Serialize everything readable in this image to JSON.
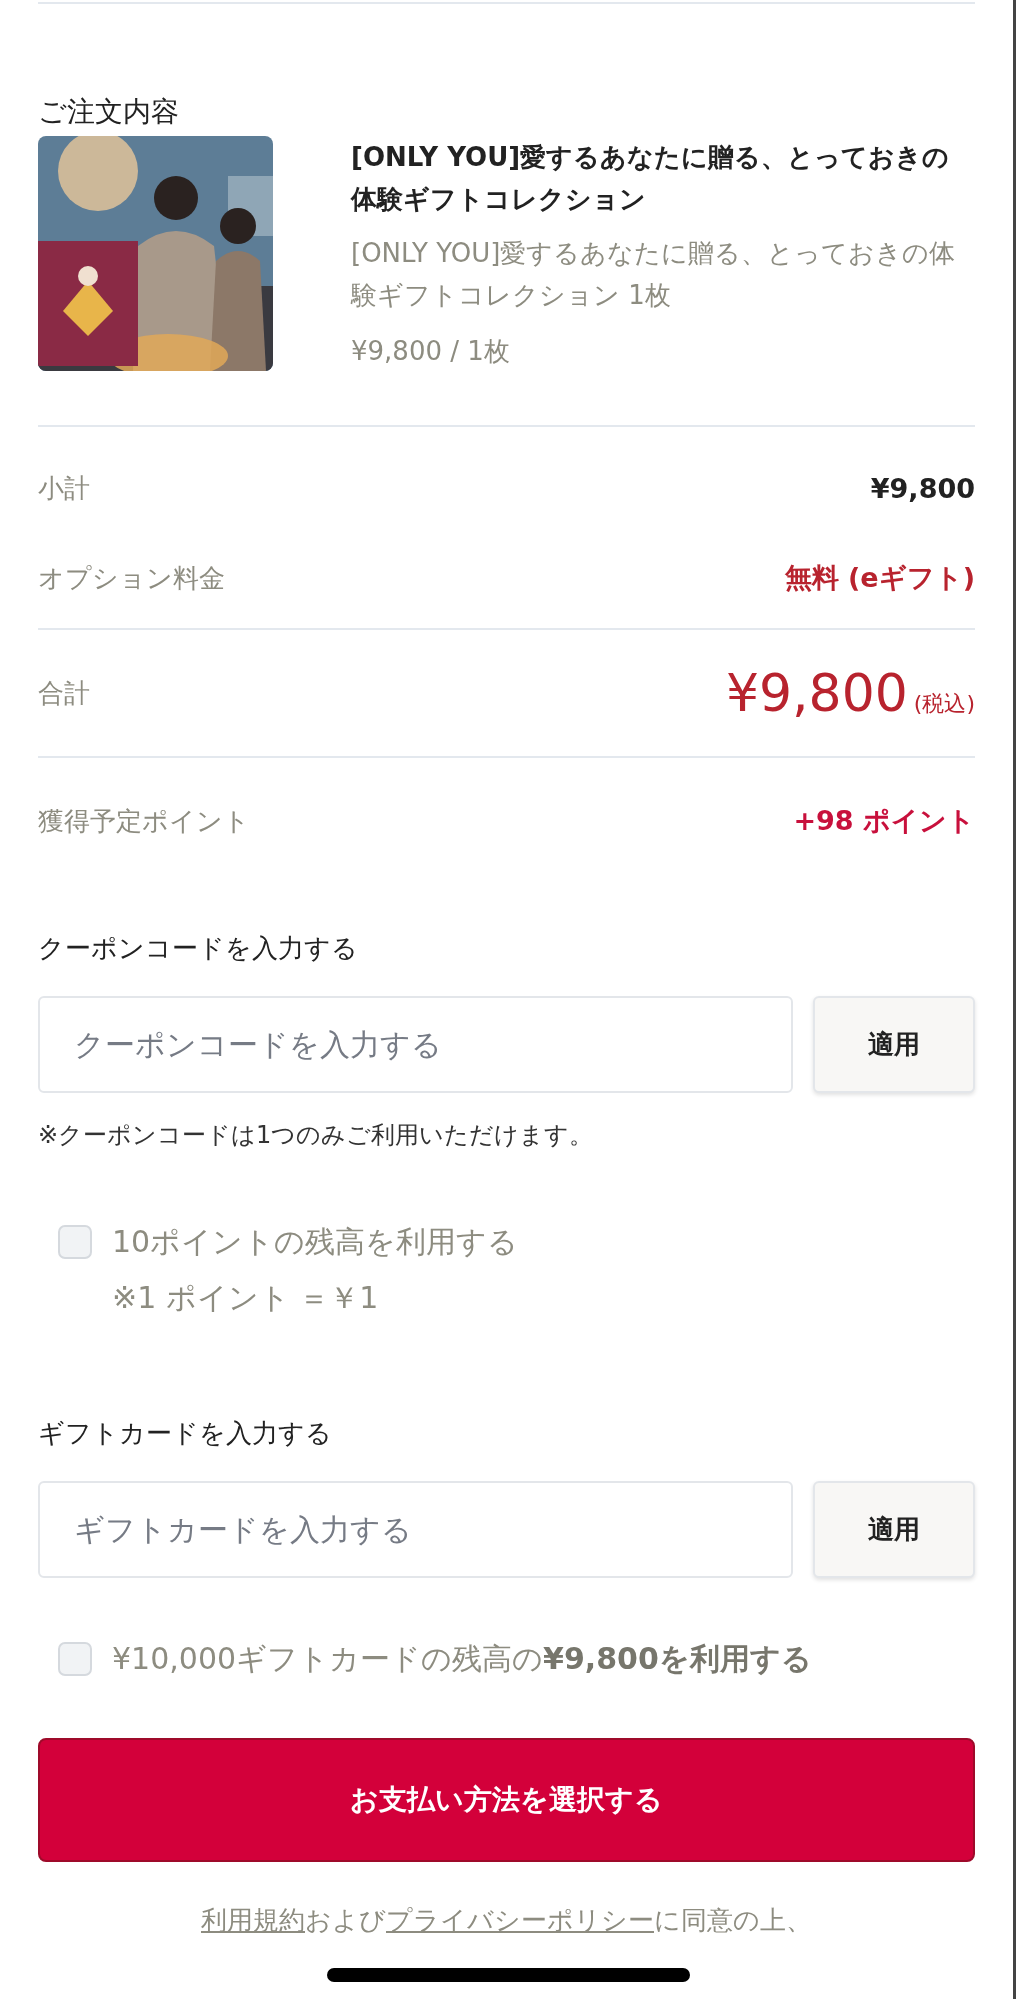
{
  "order": {
    "heading": "ご注文内容",
    "item": {
      "title": "[ONLY YOU]愛するあなたに贈る、とっておきの体験ギフトコレクション",
      "description": "[ONLY YOU]愛するあなたに贈る、とっておきの体験ギフトコレクション 1枚",
      "unit_price": "¥9,800 / 1枚"
    }
  },
  "summary": [
    {
      "label": "小計",
      "value": "¥9,800",
      "kind": "plain"
    },
    {
      "label": "オプション料金",
      "value": "無料 (eギフト)",
      "kind": "accent"
    }
  ],
  "total": {
    "label": "合計",
    "value": "¥9,800",
    "tax_note": "(税込)"
  },
  "points": {
    "label": "獲得予定ポイント",
    "value": "+98 ポイント"
  },
  "coupon": {
    "label": "クーポンコードを入力する",
    "placeholder": "クーポンコードを入力する",
    "button": "適用",
    "note": "※クーポンコードは1つのみご利用いただけます。"
  },
  "point_option": {
    "checked": false,
    "label": "10ポイントの残高を利用する",
    "note": "※1 ポイント ＝￥1"
  },
  "gift_card": {
    "label": "ギフトカードを入力する",
    "placeholder": "ギフトカードを入力する",
    "button": "適用"
  },
  "gift_option": {
    "checked": false,
    "label": "¥10,000ギフトカードの残高の**¥9,800を利用する**"
  },
  "submit": "お支払い方法を選択する",
  "agreement": [
    {
      "text": "利用規約",
      "kind": "link"
    },
    {
      "text": "および",
      "kind": "text"
    },
    {
      "text": "プライバシーポリシー",
      "kind": "link"
    },
    {
      "text": "に同意の上、",
      "kind": "text"
    }
  ]
}
